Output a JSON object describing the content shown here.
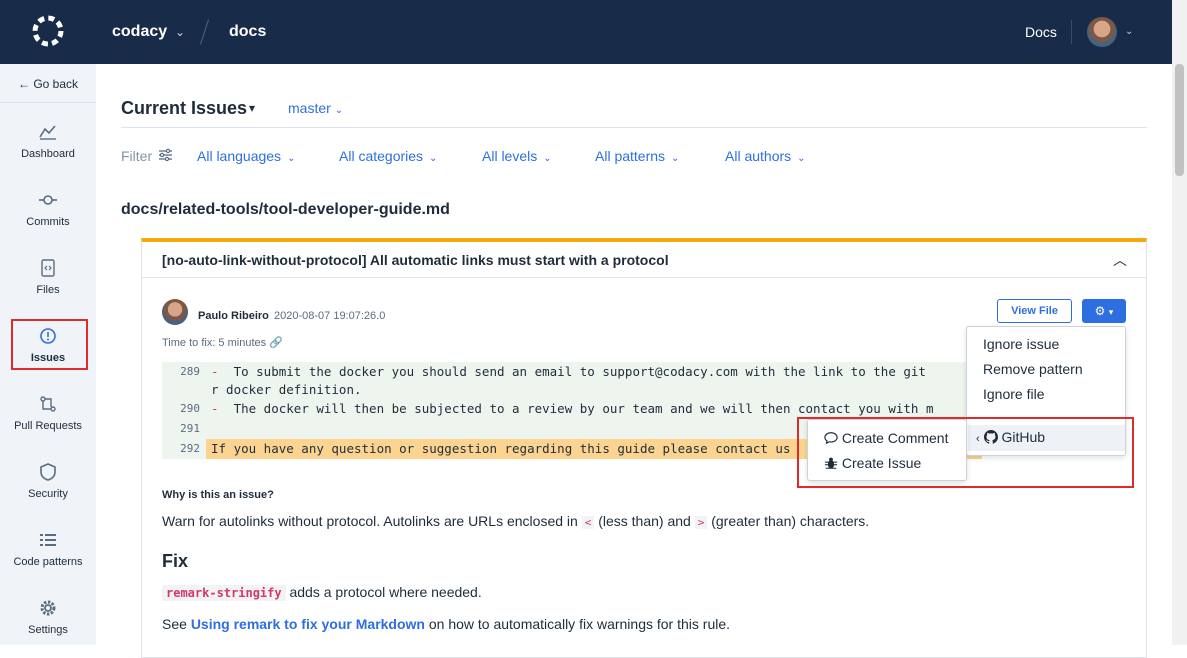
{
  "topbar": {
    "org": "codacy",
    "repo": "docs",
    "docs_link": "Docs"
  },
  "sidebar": {
    "go_back": "← Go back",
    "items": [
      {
        "label": "Dashboard",
        "icon": "chart-icon"
      },
      {
        "label": "Commits",
        "icon": "commit-icon"
      },
      {
        "label": "Files",
        "icon": "file-code-icon"
      },
      {
        "label": "Issues",
        "icon": "alert-circle-icon"
      },
      {
        "label": "Pull Requests",
        "icon": "pull-request-icon"
      },
      {
        "label": "Security",
        "icon": "shield-icon"
      },
      {
        "label": "Code patterns",
        "icon": "list-icon"
      },
      {
        "label": "Settings",
        "icon": "gear-icon"
      }
    ],
    "active": "Issues"
  },
  "main": {
    "title": "Current Issues",
    "branch": "master",
    "filter_label": "Filter",
    "filters": [
      "All languages",
      "All categories",
      "All levels",
      "All patterns",
      "All authors"
    ],
    "file_path": "docs/related-tools/tool-developer-guide.md"
  },
  "issue": {
    "title": "[no-auto-link-without-protocol] All automatic links must start with a protocol",
    "author": "Paulo Ribeiro",
    "date": "2020-08-07 19:07:26.0",
    "time_to_fix": "Time to fix: 5 minutes",
    "view_file": "View File",
    "code": [
      {
        "line": "289",
        "marker": "-",
        "text": "  To submit the docker you should send an email to support@codacy.com with the link to the git",
        "highlight": false
      },
      {
        "line": "",
        "marker": "",
        "text": "r docker definition.",
        "highlight": false
      },
      {
        "line": "290",
        "marker": "-",
        "text": "  The docker will then be subjected to a review by our team and we will then contact you with m",
        "highlight": false
      },
      {
        "line": "291",
        "marker": "",
        "text": "",
        "highlight": false
      },
      {
        "line": "292",
        "marker": "",
        "text": "If you have any question or suggestion regarding this guide please contact us",
        "highlight": true
      }
    ],
    "why_title": "Why is this an issue?",
    "why_pre": "Warn for autolinks without protocol. Autolinks are URLs enclosed in",
    "lt": "<",
    "why_mid": "(less than) and",
    "gt": ">",
    "why_post": "(greater than) characters.",
    "fix_title": "Fix",
    "fix_code": "remark-stringify",
    "fix_text": "adds a protocol where needed.",
    "see_pre": "See",
    "see_link": "Using remark to fix your Markdown",
    "see_post": "on how to automatically fix warnings for this rule."
  },
  "menu": {
    "items": [
      "Ignore issue",
      "Remove pattern",
      "Ignore file"
    ],
    "github": "GitHub",
    "submenu": [
      "Create Comment",
      "Create Issue"
    ]
  },
  "colors": {
    "topbar": "#182b48",
    "accent": "#2d6fe0",
    "warning": "#f8a80e",
    "highlight": "#fdd48f",
    "annotation": "#e02b2b"
  }
}
